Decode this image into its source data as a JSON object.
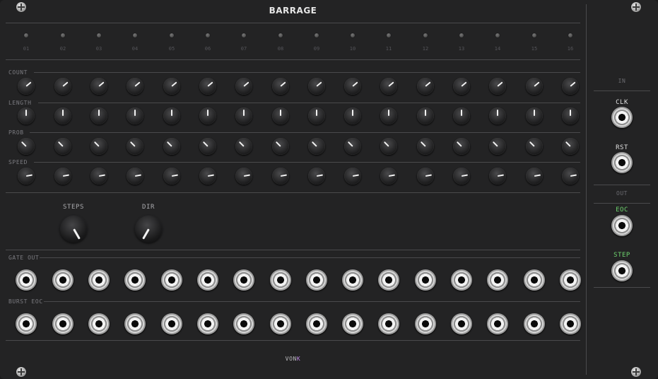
{
  "title": "BARRAGE",
  "channels": [
    "01",
    "02",
    "03",
    "04",
    "05",
    "06",
    "07",
    "08",
    "09",
    "10",
    "11",
    "12",
    "13",
    "14",
    "15",
    "16"
  ],
  "rows": [
    {
      "label": "COUNT",
      "angles": [
        -130,
        -130,
        -130,
        -130,
        -130,
        -130,
        -130,
        -130,
        -130,
        -130,
        -130,
        -130,
        -130,
        -130,
        -130,
        -130
      ]
    },
    {
      "label": "LENGTH",
      "angles": [
        180,
        180,
        180,
        180,
        180,
        180,
        180,
        180,
        180,
        180,
        180,
        180,
        180,
        180,
        180,
        180
      ]
    },
    {
      "label": "PROB",
      "angles": [
        135,
        135,
        135,
        135,
        135,
        135,
        135,
        135,
        135,
        135,
        135,
        135,
        135,
        135,
        135,
        135
      ]
    },
    {
      "label": "SPEED",
      "angles": [
        -100,
        -100,
        -100,
        -100,
        -100,
        -100,
        -100,
        -100,
        -100,
        -100,
        -100,
        -100,
        -100,
        -100,
        -100,
        -100
      ]
    }
  ],
  "steps": {
    "label": "STEPS",
    "angle": 30
  },
  "dir": {
    "label": "DIR",
    "angle": -30
  },
  "gate_out": {
    "label": "GATE OUT"
  },
  "burst_eoc": {
    "label": "BURST EOC"
  },
  "side": {
    "in_label": "IN",
    "clk_label": "CLK",
    "rst_label": "RST",
    "out_label": "OUT",
    "eoc_label": "EOC",
    "step_label": "STEP"
  },
  "colors": {
    "panel": "#232324",
    "accent_green": "#6ed36e",
    "brand_k": "#c08ae6"
  },
  "brand": {
    "prefix": "VON",
    "suffix": "K"
  }
}
